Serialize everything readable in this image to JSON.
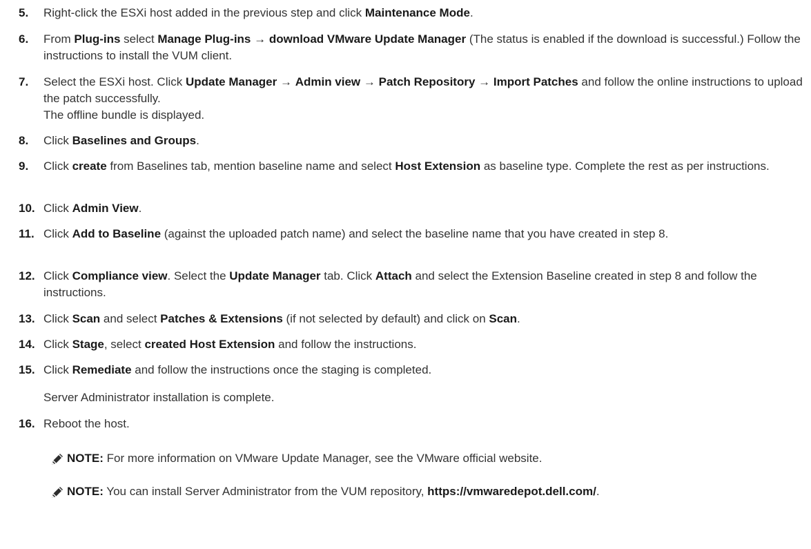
{
  "steps": [
    {
      "num": "5.",
      "runs": [
        [
          "Right-click the ESXi host added in the previous step and click ",
          0
        ],
        [
          "Maintenance Mode",
          1
        ],
        [
          ".",
          0
        ]
      ],
      "sub": ""
    },
    {
      "num": "6.",
      "runs": [
        [
          "From ",
          0
        ],
        [
          "Plug-ins",
          1
        ],
        [
          " select ",
          0
        ],
        [
          "Manage Plug-ins → download VMware Update Manager",
          1
        ],
        [
          " (The status is enabled if the download is successful.) Follow the instructions to install the VUM client.",
          0
        ]
      ],
      "sub": ""
    },
    {
      "num": "7.",
      "runs": [
        [
          "Select the ESXi host. Click ",
          0
        ],
        [
          "Update Manager",
          1
        ],
        [
          " → ",
          0
        ],
        [
          "Admin view",
          1
        ],
        [
          " → ",
          0
        ],
        [
          "Patch Repository",
          1
        ],
        [
          " → ",
          0
        ],
        [
          "Import Patches",
          1
        ],
        [
          " and follow the online instructions to upload the patch successfully.",
          0
        ]
      ],
      "sub": "The offline bundle is displayed."
    },
    {
      "num": "8.",
      "runs": [
        [
          "Click ",
          0
        ],
        [
          "Baselines and Groups",
          1
        ],
        [
          ".",
          0
        ]
      ],
      "sub": ""
    },
    {
      "num": "9.",
      "runs": [
        [
          "Click ",
          0
        ],
        [
          "create",
          1
        ],
        [
          " from Baselines tab, mention baseline name and select ",
          0
        ],
        [
          "Host Extension",
          1
        ],
        [
          " as baseline type. Complete the rest as per instructions.",
          0
        ]
      ],
      "sub": ""
    },
    {
      "num": "10.",
      "runs": [
        [
          "Click ",
          0
        ],
        [
          "Admin View",
          1
        ],
        [
          ".",
          0
        ]
      ],
      "sub": ""
    },
    {
      "num": "11.",
      "runs": [
        [
          "Click ",
          0
        ],
        [
          "Add to Baseline",
          1
        ],
        [
          " (against the uploaded patch name) and select the baseline name that you have created in step 8.",
          0
        ]
      ],
      "sub": ""
    },
    {
      "num": "12.",
      "runs": [
        [
          "Click ",
          0
        ],
        [
          "Compliance view",
          1
        ],
        [
          ". Select the ",
          0
        ],
        [
          "Update Manager",
          1
        ],
        [
          " tab. Click ",
          0
        ],
        [
          "Attach",
          1
        ],
        [
          " and select the Extension Baseline created in step 8 and follow the instructions.",
          0
        ]
      ],
      "sub": ""
    },
    {
      "num": "13.",
      "runs": [
        [
          "Click ",
          0
        ],
        [
          "Scan",
          1
        ],
        [
          " and select ",
          0
        ],
        [
          "Patches & Extensions",
          1
        ],
        [
          " (if not selected by default) and click on ",
          0
        ],
        [
          "Scan",
          1
        ],
        [
          ".",
          0
        ]
      ],
      "sub": ""
    },
    {
      "num": "14.",
      "runs": [
        [
          "Click ",
          0
        ],
        [
          "Stage",
          1
        ],
        [
          ", select ",
          0
        ],
        [
          "created Host Extension",
          1
        ],
        [
          " and follow the instructions.",
          0
        ]
      ],
      "sub": ""
    },
    {
      "num": "15.",
      "runs": [
        [
          "Click ",
          0
        ],
        [
          "Remediate",
          1
        ],
        [
          " and follow the instructions once the staging is completed.",
          0
        ]
      ],
      "sub": "Server Administrator installation is complete."
    },
    {
      "num": "16.",
      "runs": [
        [
          "Reboot the host.",
          0
        ]
      ],
      "sub": ""
    }
  ],
  "notes": [
    {
      "runs": [
        [
          "NOTE:",
          1
        ],
        [
          " For more information on VMware Update Manager, see the VMware official website.",
          0
        ]
      ]
    },
    {
      "runs": [
        [
          "NOTE:",
          1
        ],
        [
          " You can install Server Administrator from the VUM repository, ",
          0
        ],
        [
          "https://​vmwaredepot.dell.com/",
          1
        ],
        [
          ".",
          0
        ]
      ]
    }
  ],
  "icons": {
    "note": "pencil-note-icon"
  }
}
